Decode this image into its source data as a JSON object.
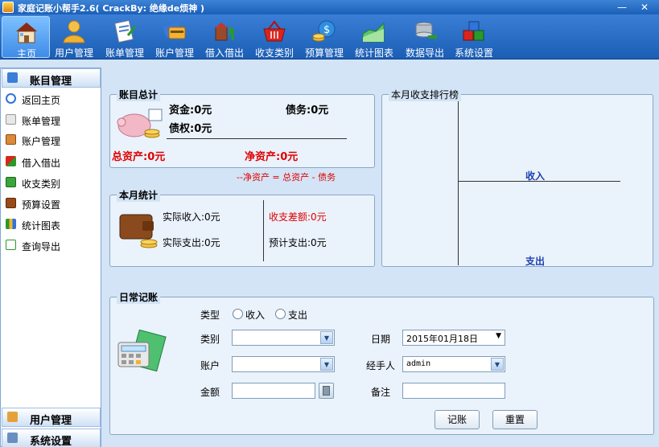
{
  "window": {
    "title": "家庭记账小帮手2.6( CrackBy: 绝缘de烦神 )",
    "minimize": "—",
    "close": "✕"
  },
  "toolbar": [
    {
      "label": "主页",
      "icon": "house-icon"
    },
    {
      "label": "用户管理",
      "icon": "user-icon"
    },
    {
      "label": "账单管理",
      "icon": "bill-icon"
    },
    {
      "label": "账户管理",
      "icon": "cards-icon"
    },
    {
      "label": "借入借出",
      "icon": "exchange-icon"
    },
    {
      "label": "收支类别",
      "icon": "basket-icon"
    },
    {
      "label": "预算管理",
      "icon": "budget-icon"
    },
    {
      "label": "统计图表",
      "icon": "area-chart-icon"
    },
    {
      "label": "数据导出",
      "icon": "database-export-icon"
    },
    {
      "label": "系统设置",
      "icon": "blocks-icon"
    }
  ],
  "sidebar": {
    "header": "账目管理",
    "items": [
      {
        "label": "返回主页",
        "icon": "back-icon"
      },
      {
        "label": "账单管理",
        "icon": "document-icon"
      },
      {
        "label": "账户管理",
        "icon": "book-icon"
      },
      {
        "label": "借入借出",
        "icon": "exchange-icon"
      },
      {
        "label": "收支类别",
        "icon": "basket-icon"
      },
      {
        "label": "预算设置",
        "icon": "wallet-icon"
      },
      {
        "label": "统计图表",
        "icon": "bar-chart-icon"
      },
      {
        "label": "查询导出",
        "icon": "export-icon"
      }
    ],
    "footer1": "用户管理",
    "footer2": "系统设置"
  },
  "summary": {
    "title": "账目总计",
    "funds": "资金:0元",
    "debt": "债务:0元",
    "claims": "债权:0元",
    "total_assets": "总资产:0元",
    "net_assets": "净资产:0元",
    "formula": "--净资产 = 总资产 - 债务"
  },
  "monthly": {
    "title": "本月统计",
    "actual_income": "实际收入:0元",
    "actual_expense": "实际支出:0元",
    "balance_diff": "收支差额:0元",
    "planned_expense": "预计支出:0元"
  },
  "ranking": {
    "title": "本月收支排行榜",
    "income": "收入",
    "expense": "支出"
  },
  "daily": {
    "title": "日常记账",
    "type_label": "类型",
    "income_option": "收入",
    "expense_option": "支出",
    "category_label": "类别",
    "category_value": "",
    "account_label": "账户",
    "account_value": "",
    "amount_label": "金额",
    "amount_value": "",
    "date_label": "日期",
    "date_value": "2015年01月18日",
    "handler_label": "经手人",
    "handler_value": "admin",
    "note_label": "备注",
    "note_value": "",
    "submit": "记账",
    "reset": "重置"
  },
  "colors": {
    "accent": "#1b5eb5",
    "red": "#e00000",
    "blue_text": "#1d3fb0"
  }
}
